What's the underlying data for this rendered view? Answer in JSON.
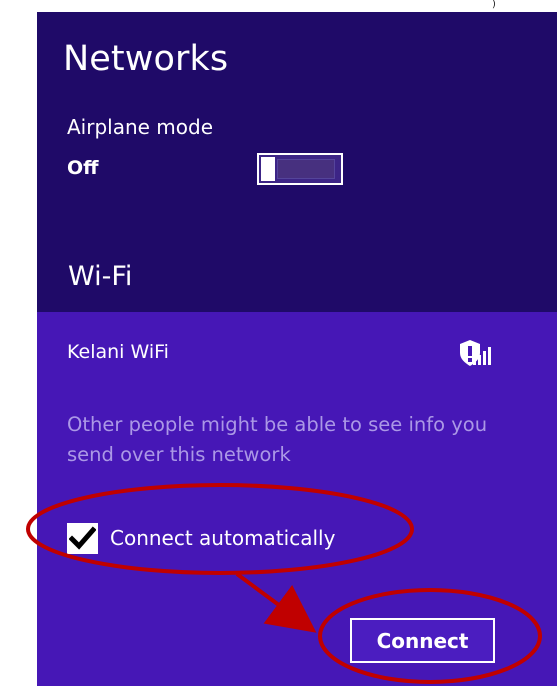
{
  "header": {
    "title": "Networks"
  },
  "airplane_mode": {
    "label": "Airplane mode",
    "state": "Off"
  },
  "wifi": {
    "section_title": "Wi-Fi",
    "network_name": "Kelani WiFi",
    "signal_icon": "secured-wifi-signal-icon",
    "warning": "Other people might be able to see info you send over this network"
  },
  "options": {
    "connect_automatically_label": "Connect automatically",
    "connect_automatically_checked": true
  },
  "actions": {
    "connect_label": "Connect"
  },
  "colors": {
    "header_background": "#1f0a68",
    "selected_network_background": "#4617b6",
    "warning_text": "#ab98e6",
    "annotation_red": "#c00000",
    "white": "#ffffff"
  }
}
